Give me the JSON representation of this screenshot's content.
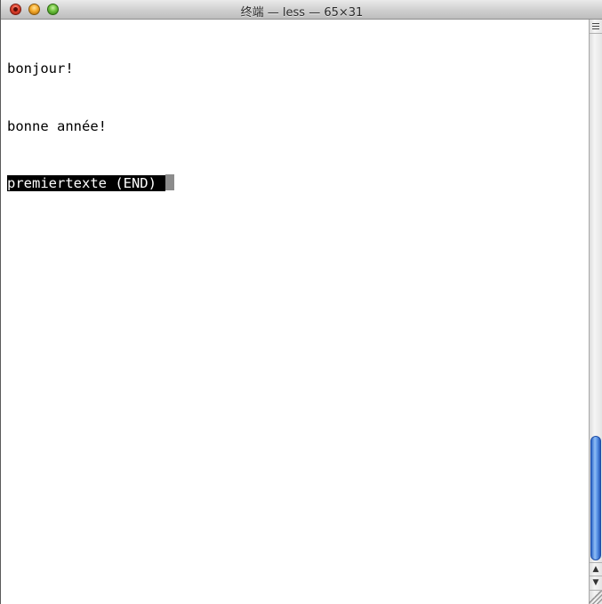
{
  "window": {
    "title": "终端 — less — 65×31"
  },
  "terminal": {
    "lines": [
      "bonjour!",
      "bonne année!"
    ],
    "status_line": "premiertexte (END)"
  },
  "icons": {
    "close": "close-button",
    "minimize": "minimize-button",
    "zoom": "zoom-button",
    "scroll_up": "arrow-up-icon",
    "scroll_down": "arrow-down-icon",
    "split": "split-pane-icon",
    "resize": "resize-grip-icon"
  },
  "colors": {
    "highlight_bg": "#000000",
    "highlight_fg": "#ffffff",
    "scroll_thumb": "#5d97e8"
  }
}
